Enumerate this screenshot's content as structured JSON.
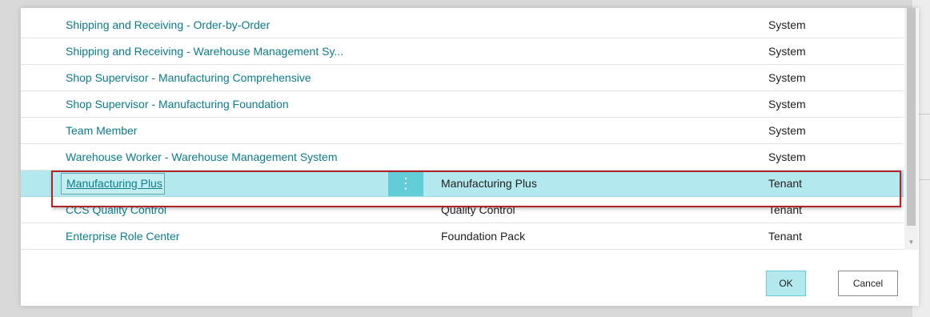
{
  "rows": [
    {
      "name": "Shipping and Receiving - Order-by-Order",
      "description": "",
      "scope": "System"
    },
    {
      "name": "Shipping and Receiving - Warehouse Management Sy...",
      "description": "",
      "scope": "System"
    },
    {
      "name": "Shop Supervisor - Manufacturing Comprehensive",
      "description": "",
      "scope": "System"
    },
    {
      "name": "Shop Supervisor - Manufacturing Foundation",
      "description": "",
      "scope": "System"
    },
    {
      "name": "Team Member",
      "description": "",
      "scope": "System"
    },
    {
      "name": "Warehouse Worker - Warehouse Management System",
      "description": "",
      "scope": "System"
    },
    {
      "name": "Manufacturing Plus",
      "description": "Manufacturing Plus",
      "scope": "Tenant",
      "selected": true
    },
    {
      "name": "CCS Quality Control",
      "description": "Quality Control",
      "scope": "Tenant"
    },
    {
      "name": "Enterprise Role Center",
      "description": "Foundation Pack",
      "scope": "Tenant"
    }
  ],
  "row_menu_icon": "⋮",
  "buttons": {
    "ok": "OK",
    "cancel": "Cancel"
  },
  "colors": {
    "link": "#0a7c8c",
    "selected_row": "#b3e9ee",
    "accent": "#62cdd8",
    "highlight_border": "#b0252a"
  }
}
